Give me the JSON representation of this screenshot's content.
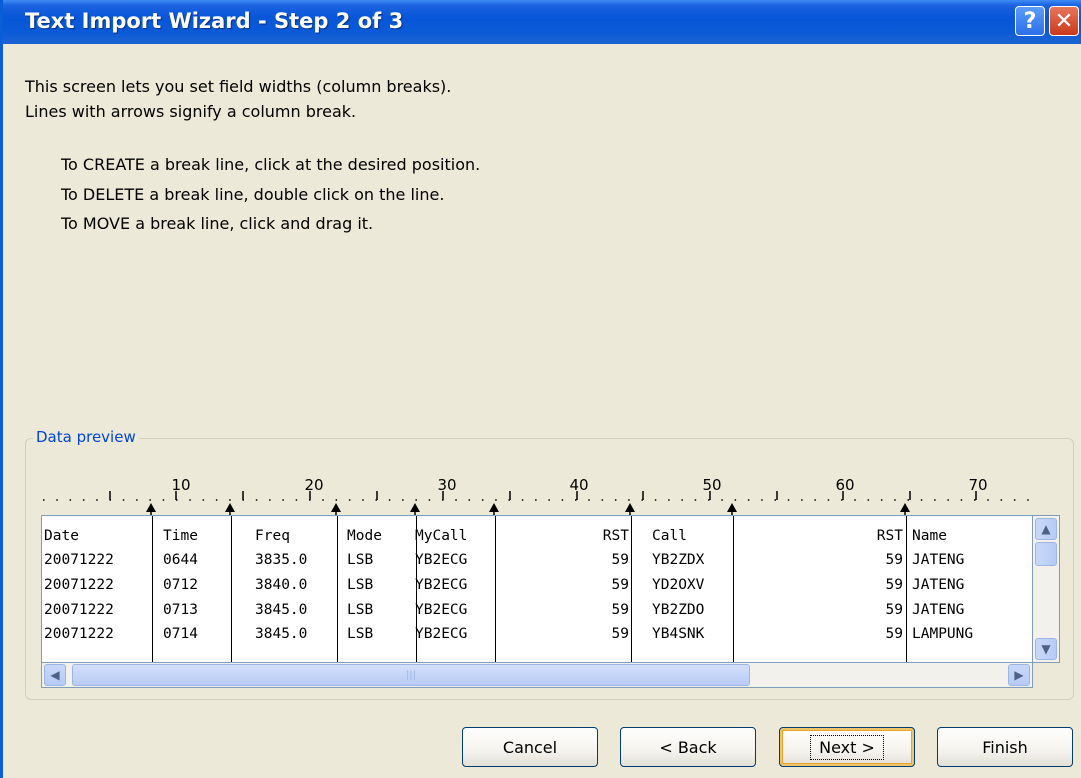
{
  "window": {
    "title": "Text Import Wizard - Step 2 of 3",
    "help_label": "?",
    "close_label": "✕"
  },
  "description": {
    "line1": "This screen lets you set field widths (column breaks).",
    "line2": "Lines with arrows signify a column break."
  },
  "instructions": [
    "To CREATE a break line, click at the desired position.",
    "To DELETE a break line, double click on the line.",
    "To MOVE a break line, click and drag it."
  ],
  "preview": {
    "group_label": "Data preview",
    "ruler_labels": [
      "10",
      "20",
      "30",
      "40",
      "50",
      "60",
      "70"
    ],
    "rows": [
      [
        "Date",
        "Time",
        "Freq",
        "Mode",
        "MyCall",
        "RST",
        "Call",
        "RST",
        "Name"
      ],
      [
        "20071222",
        "0644",
        "3835.0",
        "LSB",
        "YB2ECG",
        "59",
        "YB2ZDX",
        "59",
        "JATENG"
      ],
      [
        "20071222",
        "0712",
        "3840.0",
        "LSB",
        "YB2ECG",
        "59",
        "YD2OXV",
        "59",
        "JATENG"
      ],
      [
        "20071222",
        "0713",
        "3845.0",
        "LSB",
        "YB2ECG",
        "59",
        "YB2ZDO",
        "59",
        "JATENG"
      ],
      [
        "20071222",
        "0714",
        "3845.0",
        "LSB",
        "YB2ECG",
        "59",
        "YB4SNK",
        "59",
        "LAMPUNG"
      ]
    ]
  },
  "buttons": {
    "cancel": "Cancel",
    "back": "< Back",
    "next": "Next >",
    "finish": "Finish"
  },
  "colors": {
    "titlebar": "#0856d9",
    "dialog_bg": "#ece9d8",
    "group_label": "#0046d5",
    "close_button": "#c9391c"
  },
  "icons": {
    "help": "question-mark-icon",
    "close": "close-icon",
    "scroll_up": "chevron-up-icon",
    "scroll_down": "chevron-down-icon",
    "scroll_left": "chevron-left-icon",
    "scroll_right": "chevron-right-icon"
  }
}
